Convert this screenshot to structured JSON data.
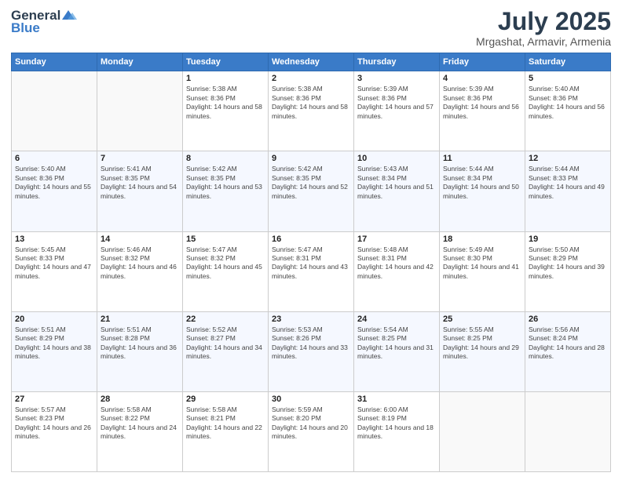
{
  "header": {
    "logo_general": "General",
    "logo_blue": "Blue",
    "month_title": "July 2025",
    "location": "Mrgashat, Armavir, Armenia"
  },
  "weekdays": [
    "Sunday",
    "Monday",
    "Tuesday",
    "Wednesday",
    "Thursday",
    "Friday",
    "Saturday"
  ],
  "weeks": [
    [
      {
        "day": "",
        "sunrise": "",
        "sunset": "",
        "daylight": ""
      },
      {
        "day": "",
        "sunrise": "",
        "sunset": "",
        "daylight": ""
      },
      {
        "day": "1",
        "sunrise": "Sunrise: 5:38 AM",
        "sunset": "Sunset: 8:36 PM",
        "daylight": "Daylight: 14 hours and 58 minutes."
      },
      {
        "day": "2",
        "sunrise": "Sunrise: 5:38 AM",
        "sunset": "Sunset: 8:36 PM",
        "daylight": "Daylight: 14 hours and 58 minutes."
      },
      {
        "day": "3",
        "sunrise": "Sunrise: 5:39 AM",
        "sunset": "Sunset: 8:36 PM",
        "daylight": "Daylight: 14 hours and 57 minutes."
      },
      {
        "day": "4",
        "sunrise": "Sunrise: 5:39 AM",
        "sunset": "Sunset: 8:36 PM",
        "daylight": "Daylight: 14 hours and 56 minutes."
      },
      {
        "day": "5",
        "sunrise": "Sunrise: 5:40 AM",
        "sunset": "Sunset: 8:36 PM",
        "daylight": "Daylight: 14 hours and 56 minutes."
      }
    ],
    [
      {
        "day": "6",
        "sunrise": "Sunrise: 5:40 AM",
        "sunset": "Sunset: 8:36 PM",
        "daylight": "Daylight: 14 hours and 55 minutes."
      },
      {
        "day": "7",
        "sunrise": "Sunrise: 5:41 AM",
        "sunset": "Sunset: 8:35 PM",
        "daylight": "Daylight: 14 hours and 54 minutes."
      },
      {
        "day": "8",
        "sunrise": "Sunrise: 5:42 AM",
        "sunset": "Sunset: 8:35 PM",
        "daylight": "Daylight: 14 hours and 53 minutes."
      },
      {
        "day": "9",
        "sunrise": "Sunrise: 5:42 AM",
        "sunset": "Sunset: 8:35 PM",
        "daylight": "Daylight: 14 hours and 52 minutes."
      },
      {
        "day": "10",
        "sunrise": "Sunrise: 5:43 AM",
        "sunset": "Sunset: 8:34 PM",
        "daylight": "Daylight: 14 hours and 51 minutes."
      },
      {
        "day": "11",
        "sunrise": "Sunrise: 5:44 AM",
        "sunset": "Sunset: 8:34 PM",
        "daylight": "Daylight: 14 hours and 50 minutes."
      },
      {
        "day": "12",
        "sunrise": "Sunrise: 5:44 AM",
        "sunset": "Sunset: 8:33 PM",
        "daylight": "Daylight: 14 hours and 49 minutes."
      }
    ],
    [
      {
        "day": "13",
        "sunrise": "Sunrise: 5:45 AM",
        "sunset": "Sunset: 8:33 PM",
        "daylight": "Daylight: 14 hours and 47 minutes."
      },
      {
        "day": "14",
        "sunrise": "Sunrise: 5:46 AM",
        "sunset": "Sunset: 8:32 PM",
        "daylight": "Daylight: 14 hours and 46 minutes."
      },
      {
        "day": "15",
        "sunrise": "Sunrise: 5:47 AM",
        "sunset": "Sunset: 8:32 PM",
        "daylight": "Daylight: 14 hours and 45 minutes."
      },
      {
        "day": "16",
        "sunrise": "Sunrise: 5:47 AM",
        "sunset": "Sunset: 8:31 PM",
        "daylight": "Daylight: 14 hours and 43 minutes."
      },
      {
        "day": "17",
        "sunrise": "Sunrise: 5:48 AM",
        "sunset": "Sunset: 8:31 PM",
        "daylight": "Daylight: 14 hours and 42 minutes."
      },
      {
        "day": "18",
        "sunrise": "Sunrise: 5:49 AM",
        "sunset": "Sunset: 8:30 PM",
        "daylight": "Daylight: 14 hours and 41 minutes."
      },
      {
        "day": "19",
        "sunrise": "Sunrise: 5:50 AM",
        "sunset": "Sunset: 8:29 PM",
        "daylight": "Daylight: 14 hours and 39 minutes."
      }
    ],
    [
      {
        "day": "20",
        "sunrise": "Sunrise: 5:51 AM",
        "sunset": "Sunset: 8:29 PM",
        "daylight": "Daylight: 14 hours and 38 minutes."
      },
      {
        "day": "21",
        "sunrise": "Sunrise: 5:51 AM",
        "sunset": "Sunset: 8:28 PM",
        "daylight": "Daylight: 14 hours and 36 minutes."
      },
      {
        "day": "22",
        "sunrise": "Sunrise: 5:52 AM",
        "sunset": "Sunset: 8:27 PM",
        "daylight": "Daylight: 14 hours and 34 minutes."
      },
      {
        "day": "23",
        "sunrise": "Sunrise: 5:53 AM",
        "sunset": "Sunset: 8:26 PM",
        "daylight": "Daylight: 14 hours and 33 minutes."
      },
      {
        "day": "24",
        "sunrise": "Sunrise: 5:54 AM",
        "sunset": "Sunset: 8:25 PM",
        "daylight": "Daylight: 14 hours and 31 minutes."
      },
      {
        "day": "25",
        "sunrise": "Sunrise: 5:55 AM",
        "sunset": "Sunset: 8:25 PM",
        "daylight": "Daylight: 14 hours and 29 minutes."
      },
      {
        "day": "26",
        "sunrise": "Sunrise: 5:56 AM",
        "sunset": "Sunset: 8:24 PM",
        "daylight": "Daylight: 14 hours and 28 minutes."
      }
    ],
    [
      {
        "day": "27",
        "sunrise": "Sunrise: 5:57 AM",
        "sunset": "Sunset: 8:23 PM",
        "daylight": "Daylight: 14 hours and 26 minutes."
      },
      {
        "day": "28",
        "sunrise": "Sunrise: 5:58 AM",
        "sunset": "Sunset: 8:22 PM",
        "daylight": "Daylight: 14 hours and 24 minutes."
      },
      {
        "day": "29",
        "sunrise": "Sunrise: 5:58 AM",
        "sunset": "Sunset: 8:21 PM",
        "daylight": "Daylight: 14 hours and 22 minutes."
      },
      {
        "day": "30",
        "sunrise": "Sunrise: 5:59 AM",
        "sunset": "Sunset: 8:20 PM",
        "daylight": "Daylight: 14 hours and 20 minutes."
      },
      {
        "day": "31",
        "sunrise": "Sunrise: 6:00 AM",
        "sunset": "Sunset: 8:19 PM",
        "daylight": "Daylight: 14 hours and 18 minutes."
      },
      {
        "day": "",
        "sunrise": "",
        "sunset": "",
        "daylight": ""
      },
      {
        "day": "",
        "sunrise": "",
        "sunset": "",
        "daylight": ""
      }
    ]
  ]
}
